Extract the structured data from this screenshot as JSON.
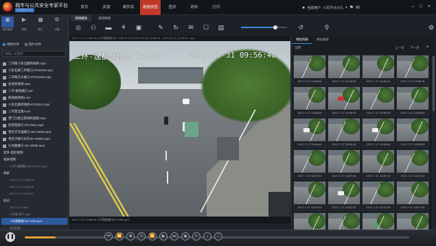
{
  "app": {
    "title": "城市与公共安全专家平台",
    "subtitle": "视频图侦系统"
  },
  "nav_tabs": [
    {
      "label": "首页"
    },
    {
      "label": "资源"
    },
    {
      "label": "案件库"
    },
    {
      "label": "视频侦查"
    },
    {
      "label": "图侦"
    },
    {
      "label": "研判"
    },
    {
      "label": "打印"
    }
  ],
  "active_nav_index": 3,
  "user": {
    "name": "当前用户",
    "org": "分局刑侦大队",
    "icons": [
      "user-icon",
      "bell-icon",
      "message-icon"
    ]
  },
  "window_controls": [
    "minimize",
    "maximize",
    "close"
  ],
  "left_panel": {
    "tools": [
      {
        "label": "案件管理",
        "icon": "folder-icon"
      },
      {
        "label": "视频",
        "icon": "video-icon"
      },
      {
        "label": "图片",
        "icon": "image-icon"
      },
      {
        "label": "设置",
        "icon": "gear-icon"
      }
    ],
    "radio_options": [
      {
        "label": "视频文件",
        "selected": true
      },
      {
        "label": "图片文件",
        "selected": false
      }
    ],
    "search_placeholder": "请输入关键字",
    "files": [
      "二环路人民北路跨线桥.mp4",
      "人民北路二环路口-IPC5310.mp4",
      "二环路交大路口-IPC01100.mp4",
      "高架桥南侧.mp4",
      "二环-解放路口.avi",
      "解放路南侧1.avi",
      "人民北路跨线桥-IPC0021.mp4",
      "二环西北角3.avi",
      "营门口路全景球机视频.mp4",
      "抚琴西路口-IPC3301.mp4",
      "茶店子交通路口-3K+200M.mp4",
      "茶店子路口东向3K+200M.mp4",
      "沙湾路路口-3K+200M.mp4"
    ],
    "group_a": "案件-监控视频",
    "group_b": "相关视频",
    "group_b_item": "[二环-逸都路] 2013-10-31.mp4",
    "group_c": "线索",
    "group_c_items": [
      "2017-7-17 13:56:00",
      "2017-7-17 13:56:45",
      "2017-7-17 13:57:22"
    ],
    "group_d": "标记",
    "group_d_items": [
      "2017-7-17.mp4",
      "二环路-桥下.mp4",
      "二环逸都路口K7+090.mp4"
    ],
    "selected_item": "二环逸都路口K7+090.mp4",
    "last_item": "导出目录"
  },
  "toolbar": {
    "subtabs": [
      "视频播放",
      "视频摘要"
    ],
    "tools": [
      {
        "icon": "target-icon",
        "name": "track"
      },
      {
        "icon": "person-icon",
        "name": "person"
      },
      {
        "icon": "car-icon",
        "name": "vehicle"
      },
      {
        "icon": "bike-icon",
        "name": "nonmotor"
      },
      {
        "icon": "cube-icon",
        "name": "3d"
      },
      {
        "icon": "pencil-icon",
        "name": "mark"
      },
      {
        "icon": "loop-icon",
        "name": "loop"
      },
      {
        "icon": "chat-icon",
        "name": "note"
      },
      {
        "icon": "crop-icon",
        "name": "crop"
      },
      {
        "icon": "layers-icon",
        "name": "layers"
      },
      {
        "icon": "camera-icon",
        "name": "snapshot"
      },
      {
        "icon": "refresh-icon",
        "name": "refresh"
      },
      {
        "icon": "search-icon",
        "name": "search"
      },
      {
        "icon": "gear-icon",
        "name": "settings"
      }
    ],
    "speed_fraction": 0.75
  },
  "video": {
    "info": "2017-7-17 13:56:00  [二环逸都路口K7+090 01-IPC] 2013-10-31 09:56:48 - 2013-10-31 10:00:00 .mp4",
    "overlay_title": "二环-逸都路路口K7+090",
    "overlay_time": "2013-10-31 09:56:48",
    "bottom_text": "2017-7-17 13:56:00  二环逸都路口K7+090.mp4"
  },
  "right_panel": {
    "tabs": [
      "目标列表",
      "目标搜索"
    ],
    "filter_label": "全部",
    "pager": [
      "上一页",
      "下一页"
    ],
    "thumbnails": [
      {
        "cap": "2017-7-17 13:56:00",
        "obj": "none"
      },
      {
        "cap": "2017-7-17 13:56:05",
        "obj": "none"
      },
      {
        "cap": "2017-7-17 13:56:10",
        "obj": "none"
      },
      {
        "cap": "2017-7-17 13:56:15",
        "obj": "none"
      },
      {
        "cap": "2017-7-17 13:56:20",
        "obj": "none"
      },
      {
        "cap": "2017-7-17 13:56:25",
        "obj": "red"
      },
      {
        "cap": "2017-7-17 13:56:30",
        "obj": "none"
      },
      {
        "cap": "2017-7-17 13:56:35",
        "obj": "none"
      },
      {
        "cap": "2017-7-17 13:56:40",
        "obj": "white"
      },
      {
        "cap": "2017-7-17 13:56:45",
        "obj": "none"
      },
      {
        "cap": "2017-7-17 13:56:50",
        "obj": "white"
      },
      {
        "cap": "2017-7-17 13:56:55",
        "obj": "none"
      },
      {
        "cap": "2017-7-17 13:57:00",
        "obj": "none"
      },
      {
        "cap": "2017-7-17 13:57:05",
        "obj": "none"
      },
      {
        "cap": "2017-7-17 13:57:10",
        "obj": "none"
      },
      {
        "cap": "2017-7-17 13:57:15",
        "obj": "none"
      },
      {
        "cap": "2017-7-17 13:57:20",
        "obj": "none"
      },
      {
        "cap": "2017-7-17 13:57:25",
        "obj": "white"
      },
      {
        "cap": "2017-7-17 13:57:30",
        "obj": "none"
      },
      {
        "cap": "2017-7-17 13:57:35",
        "obj": "none"
      },
      {
        "cap": "2017-7-17 13:57:40",
        "obj": "none"
      },
      {
        "cap": "2017-7-17 13:57:45",
        "obj": "none"
      },
      {
        "cap": "2017-7-17 13:57:50",
        "obj": "green"
      },
      {
        "cap": "2017-7-17 13:57:55",
        "obj": "none"
      }
    ]
  },
  "playback": {
    "progress_fraction": 0.08,
    "buttons": [
      "prev-icon",
      "rewind-icon",
      "stop-icon",
      "slow-icon",
      "fast-icon",
      "step-icon",
      "next-icon",
      "snapshot-icon",
      "clip-icon",
      "volume-icon",
      "fullscreen-icon"
    ]
  }
}
